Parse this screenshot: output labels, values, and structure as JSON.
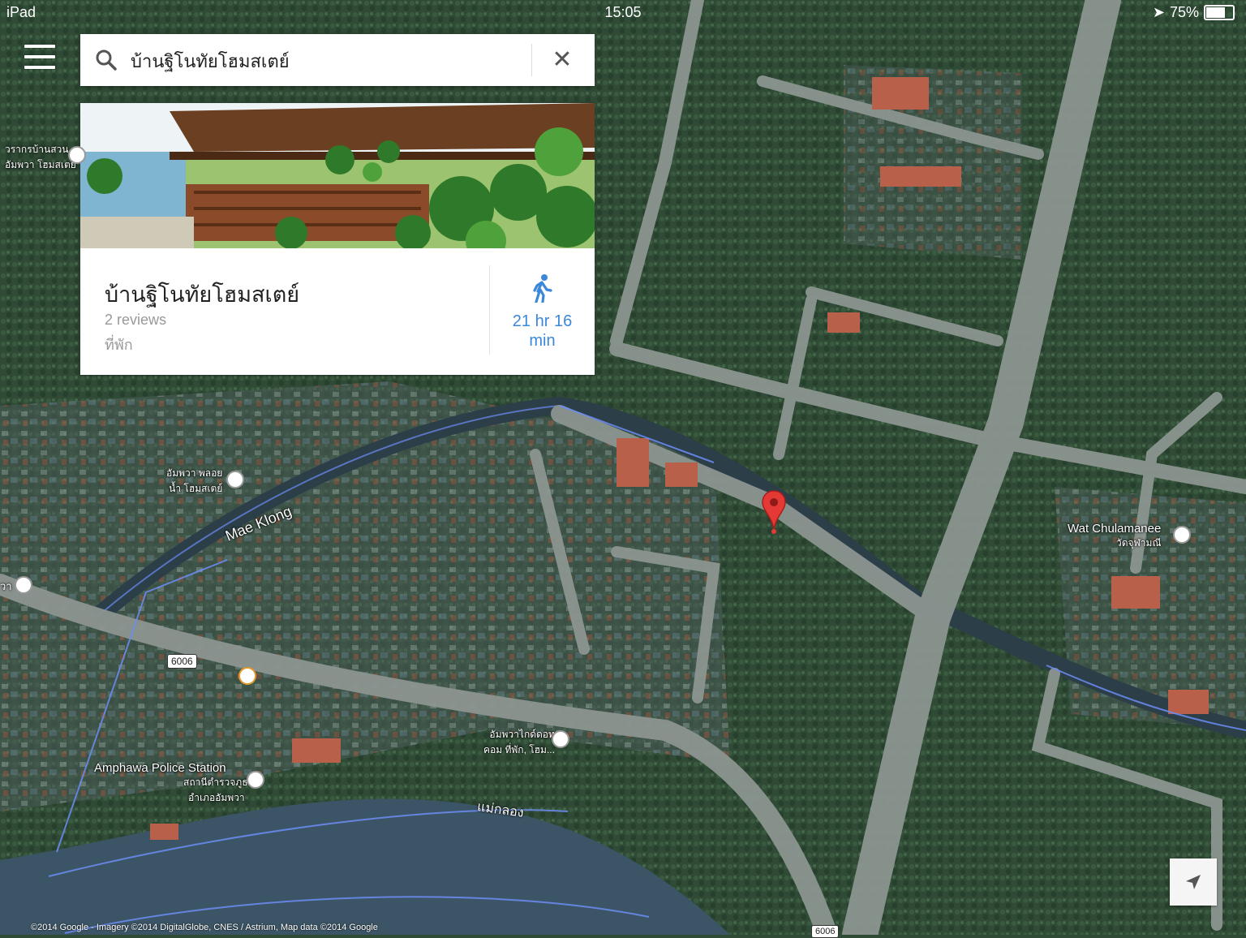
{
  "status_bar": {
    "device": "iPad",
    "time": "15:05",
    "battery": "75%",
    "battery_level": 0.75
  },
  "search": {
    "query": "บ้านฐิโนทัยโฮมสเตย์"
  },
  "place_card": {
    "title": "บ้านฐิโนทัยโฮมสเตย์",
    "reviews": "2 reviews",
    "category": "ที่พัก",
    "walk_time_line1": "21 hr 16",
    "walk_time_line2": "min"
  },
  "map_labels": {
    "river": "Mae Klong",
    "river_thai": "แม่กลอง",
    "temple": "Wat Chulamanee",
    "temple_thai": "วัดจุฬามณี",
    "police": "Amphawa Police Station",
    "police_thai_1": "สถานีตำรวจภูธร",
    "police_thai_2": "อำเภออัมพวา",
    "homestay1_1": "อัมพวา พลอย",
    "homestay1_2": "น้ำ โฮมสเตย์",
    "homestay2_1": "อัมพวาไกด์ดอท",
    "homestay2_2": "คอม ที่พัก, โฮม...",
    "topleft_1": "วรากรบ้านสวน",
    "topleft_2": "อัมพวา โฮมสเตย์",
    "left_edge": "วา",
    "route1": "6006",
    "route2": "6006"
  },
  "copyright": "©2014 Google - Imagery ©2014 DigitalGlobe, CNES / Astrium, Map data ©2014 Google",
  "colors": {
    "accent_blue": "#3b87d9",
    "pin_red": "#e53935",
    "vegetation": "#2f4a35",
    "river": "#3c5566"
  },
  "icons": [
    "menu-icon",
    "search-icon",
    "close-icon",
    "walking-icon",
    "map-pin-icon",
    "my-location-icon",
    "hotel-icon",
    "cafe-icon",
    "temple-icon",
    "police-icon"
  ]
}
